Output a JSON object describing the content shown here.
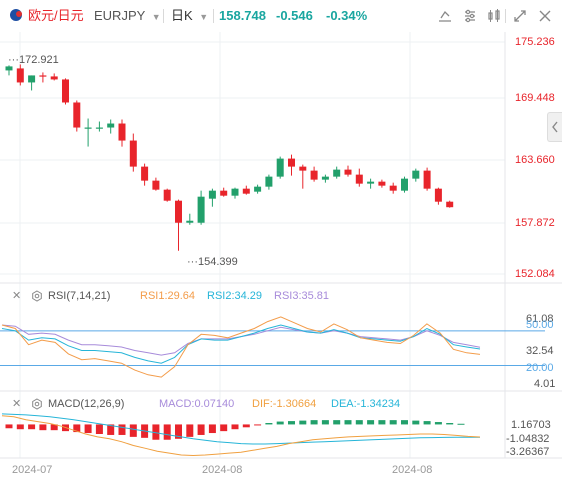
{
  "header": {
    "instrument_name": "欧元/日元",
    "symbol": "EURJPY",
    "timeframe": "日K",
    "price": "158.748",
    "change": "-0.546",
    "change_pct": "-0.34%"
  },
  "colors": {
    "up": "#22a06b",
    "down": "#e8242b",
    "price_axis": "#e8242b"
  },
  "toolbar_icons": [
    "draw-icon",
    "settings-icon",
    "indicators-icon",
    "fullscreen-icon",
    "close-icon"
  ],
  "main_chart": {
    "price_axis": [
      "175.236",
      "169.448",
      "163.660",
      "157.872",
      "152.084"
    ],
    "high_label": "172.921",
    "low_label": "154.399",
    "ylim": [
      152.084,
      175.236
    ],
    "candles": [
      {
        "o": 172.4,
        "h": 172.9,
        "l": 171.9,
        "c": 172.8
      },
      {
        "o": 172.6,
        "h": 173.0,
        "l": 170.9,
        "c": 171.2
      },
      {
        "o": 171.2,
        "h": 171.9,
        "l": 170.4,
        "c": 171.9
      },
      {
        "o": 171.9,
        "h": 172.2,
        "l": 171.2,
        "c": 171.8
      },
      {
        "o": 171.8,
        "h": 172.1,
        "l": 171.4,
        "c": 171.5
      },
      {
        "o": 171.5,
        "h": 171.6,
        "l": 169.0,
        "c": 169.2
      },
      {
        "o": 169.2,
        "h": 169.4,
        "l": 166.3,
        "c": 166.7
      },
      {
        "o": 166.7,
        "h": 167.6,
        "l": 164.8,
        "c": 166.7
      },
      {
        "o": 166.7,
        "h": 167.3,
        "l": 166.3,
        "c": 166.7
      },
      {
        "o": 166.7,
        "h": 167.5,
        "l": 166.1,
        "c": 167.1
      },
      {
        "o": 167.1,
        "h": 167.5,
        "l": 164.8,
        "c": 165.4
      },
      {
        "o": 165.4,
        "h": 166.1,
        "l": 162.3,
        "c": 162.8
      },
      {
        "o": 162.8,
        "h": 163.1,
        "l": 160.9,
        "c": 161.4
      },
      {
        "o": 161.4,
        "h": 161.7,
        "l": 160.4,
        "c": 160.5
      },
      {
        "o": 160.5,
        "h": 160.6,
        "l": 159.3,
        "c": 159.4
      },
      {
        "o": 159.4,
        "h": 159.5,
        "l": 154.4,
        "c": 157.2
      },
      {
        "o": 157.2,
        "h": 158.1,
        "l": 157.0,
        "c": 157.4
      },
      {
        "o": 157.2,
        "h": 160.4,
        "l": 157.0,
        "c": 159.8
      },
      {
        "o": 159.6,
        "h": 160.6,
        "l": 158.8,
        "c": 160.4
      },
      {
        "o": 160.4,
        "h": 160.7,
        "l": 159.8,
        "c": 159.9
      },
      {
        "o": 159.9,
        "h": 160.7,
        "l": 159.6,
        "c": 160.6
      },
      {
        "o": 160.6,
        "h": 160.9,
        "l": 160.0,
        "c": 160.1
      },
      {
        "o": 160.3,
        "h": 161.0,
        "l": 160.1,
        "c": 160.8
      },
      {
        "o": 160.8,
        "h": 162.0,
        "l": 160.5,
        "c": 161.8
      },
      {
        "o": 161.8,
        "h": 163.8,
        "l": 161.6,
        "c": 163.6
      },
      {
        "o": 163.6,
        "h": 164.0,
        "l": 161.9,
        "c": 162.8
      },
      {
        "o": 162.8,
        "h": 163.0,
        "l": 160.6,
        "c": 162.4
      },
      {
        "o": 162.4,
        "h": 162.8,
        "l": 161.3,
        "c": 161.5
      },
      {
        "o": 161.5,
        "h": 162.0,
        "l": 161.2,
        "c": 161.8
      },
      {
        "o": 161.8,
        "h": 162.8,
        "l": 161.6,
        "c": 162.5
      },
      {
        "o": 162.5,
        "h": 162.9,
        "l": 161.8,
        "c": 162.0
      },
      {
        "o": 162.0,
        "h": 162.6,
        "l": 160.8,
        "c": 161.1
      },
      {
        "o": 161.1,
        "h": 161.6,
        "l": 160.6,
        "c": 161.3
      },
      {
        "o": 161.3,
        "h": 161.5,
        "l": 160.7,
        "c": 160.9
      },
      {
        "o": 160.9,
        "h": 161.2,
        "l": 160.1,
        "c": 160.4
      },
      {
        "o": 160.4,
        "h": 161.8,
        "l": 160.2,
        "c": 161.6
      },
      {
        "o": 161.6,
        "h": 162.6,
        "l": 161.3,
        "c": 162.4
      },
      {
        "o": 162.4,
        "h": 162.7,
        "l": 160.4,
        "c": 160.6
      },
      {
        "o": 160.6,
        "h": 160.7,
        "l": 159.0,
        "c": 159.3
      },
      {
        "o": 159.3,
        "h": 159.4,
        "l": 158.7,
        "c": 158.75
      }
    ]
  },
  "rsi": {
    "label": "RSI(7,14,21)",
    "rsi1": "RSI1:29.64",
    "rsi2": "RSI2:34.29",
    "rsi3": "RSI3:35.81",
    "axis": [
      "61.08",
      "50.00",
      "32.54",
      "20.00",
      "4.01"
    ],
    "ylim": [
      4.01,
      61.08
    ],
    "levels": [
      50,
      20
    ],
    "colors": {
      "rsi1": "#f39c4a",
      "rsi2": "#26b5d8",
      "rsi3": "#a78bda",
      "level": "#5aa9e6"
    },
    "rsi1_values": [
      55,
      52,
      38,
      42,
      40,
      30,
      25,
      26,
      24,
      22,
      16,
      12,
      10,
      19,
      38,
      47,
      46,
      44,
      48,
      52,
      58,
      62,
      57,
      52,
      49,
      56,
      51,
      44,
      42,
      40,
      39,
      46,
      56,
      48,
      34,
      31,
      29.64
    ],
    "rsi2_values": [
      52,
      50,
      42,
      44,
      43,
      37,
      33,
      33,
      32,
      31,
      27,
      24,
      22,
      27,
      38,
      43,
      42,
      42,
      45,
      48,
      52,
      55,
      52,
      49,
      48,
      51,
      48,
      44,
      43,
      42,
      41,
      45,
      52,
      47,
      38,
      36,
      34.29
    ],
    "rsi3_values": [
      55,
      54,
      47,
      48,
      47,
      42,
      38,
      38,
      37,
      36,
      33,
      31,
      29,
      31,
      39,
      43,
      43,
      43,
      45,
      47,
      50,
      53,
      51,
      49,
      48,
      50,
      48,
      45,
      44,
      43,
      42,
      45,
      50,
      46,
      40,
      38,
      35.81
    ]
  },
  "macd": {
    "label": "MACD(12,26,9)",
    "macd_value": "MACD:0.07140",
    "dif": "DIF:-1.30664",
    "dea": "DEA:-1.34234",
    "axis": [
      "1.16703",
      "-1.04832",
      "-3.26367"
    ],
    "ylim": [
      -3.3,
      1.3
    ],
    "colors": {
      "macd": "#a78bda",
      "dif": "#f0a040",
      "dea": "#26b5d8",
      "pos": "#22a06b",
      "neg": "#e8242b"
    },
    "hist": [
      -0.4,
      -0.5,
      -0.5,
      -0.6,
      -0.6,
      -0.7,
      -0.8,
      -0.9,
      -1.0,
      -1.1,
      -1.1,
      -1.3,
      -1.4,
      -1.6,
      -1.6,
      -1.5,
      -1.3,
      -1.1,
      -0.9,
      -0.7,
      -0.5,
      -0.3,
      -0.1,
      0.15,
      0.3,
      0.35,
      0.4,
      0.45,
      0.45,
      0.45,
      0.45,
      0.45,
      0.45,
      0.45,
      0.45,
      0.45,
      0.4,
      0.35,
      0.25,
      0.15,
      0.07
    ],
    "dif_values": [
      0.9,
      0.8,
      0.5,
      0.3,
      0.1,
      -0.2,
      -0.6,
      -1.0,
      -1.3,
      -1.5,
      -1.8,
      -2.2,
      -2.5,
      -2.8,
      -3.0,
      -3.2,
      -3.25,
      -3.2,
      -3.1,
      -3.0,
      -2.9,
      -2.7,
      -2.5,
      -2.3,
      -2.0,
      -1.8,
      -1.6,
      -1.5,
      -1.4,
      -1.3,
      -1.25,
      -1.2,
      -1.15,
      -1.1,
      -1.05,
      -1.0,
      -1.0,
      -1.05,
      -1.15,
      -1.25,
      -1.31
    ],
    "dea_values": [
      1.1,
      1.05,
      1.0,
      0.9,
      0.8,
      0.65,
      0.5,
      0.3,
      0.1,
      -0.1,
      -0.3,
      -0.5,
      -0.7,
      -0.9,
      -1.1,
      -1.3,
      -1.5,
      -1.65,
      -1.8,
      -1.9,
      -2.0,
      -2.05,
      -2.05,
      -2.0,
      -1.95,
      -1.9,
      -1.85,
      -1.8,
      -1.75,
      -1.7,
      -1.65,
      -1.6,
      -1.55,
      -1.5,
      -1.45,
      -1.4,
      -1.38,
      -1.36,
      -1.35,
      -1.345,
      -1.342
    ]
  },
  "x_axis": [
    "2024-07",
    "2024-08",
    "2024-08"
  ]
}
